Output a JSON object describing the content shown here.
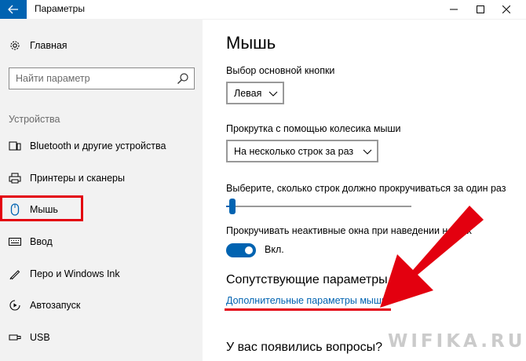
{
  "window": {
    "title": "Параметры"
  },
  "sidebar": {
    "home_label": "Главная",
    "search_placeholder": "Найти параметр",
    "section_label": "Устройства",
    "items": [
      {
        "label": "Bluetooth и другие устройства",
        "icon": "bluetooth-icon"
      },
      {
        "label": "Принтеры и сканеры",
        "icon": "printer-icon"
      },
      {
        "label": "Мышь",
        "icon": "mouse-icon",
        "selected": true
      },
      {
        "label": "Ввод",
        "icon": "keyboard-icon"
      },
      {
        "label": "Перо и Windows Ink",
        "icon": "pen-icon"
      },
      {
        "label": "Автозапуск",
        "icon": "autoplay-icon"
      },
      {
        "label": "USB",
        "icon": "usb-icon"
      }
    ]
  },
  "main": {
    "title": "Мышь",
    "primary_button_label": "Выбор основной кнопки",
    "primary_button_value": "Левая",
    "scroll_label": "Прокрутка с помощью колесика мыши",
    "scroll_value": "На несколько строк за раз",
    "lines_label": "Выберите, сколько строк должно прокручиваться за один раз",
    "lines_slider_level": 0.02,
    "inactive_scroll_label": "Прокручивать неактивные окна при наведении на них",
    "inactive_scroll_state": "Вкл.",
    "related_title": "Сопутствующие параметры",
    "related_link": "Дополнительные параметры мыши",
    "question_title": "У вас появились вопросы?"
  },
  "watermark": {
    "text": "WIFIKA.RU"
  },
  "colors": {
    "accent": "#0063b1",
    "highlight": "#e3000f",
    "sidebar_bg": "#f2f2f2"
  }
}
